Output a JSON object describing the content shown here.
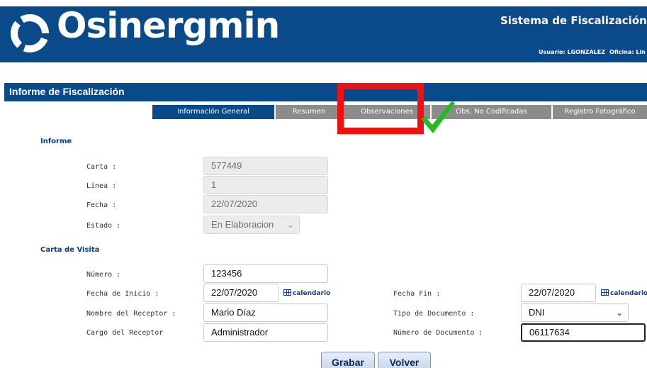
{
  "header": {
    "brand": "Osinergmin",
    "system_title": "Sistema de Fiscalización e",
    "user_label": "Usuario: LGONZALEZ",
    "office_label": "Oficina: Lin"
  },
  "section": {
    "title": "Informe de Fiscalización"
  },
  "tabs": [
    {
      "label": "Información General",
      "active": true
    },
    {
      "label": "Resumen",
      "active": false
    },
    {
      "label": "Observaciones",
      "active": false
    },
    {
      "label": "Obs. No Codificadas",
      "active": false
    },
    {
      "label": "Registro Fotográfico",
      "active": false
    }
  ],
  "informe": {
    "title": "Informe",
    "carta_label": "Carta :",
    "carta_value": "577449",
    "linea_label": "Línea :",
    "linea_value": "1",
    "fecha_label": "Fecha :",
    "fecha_value": "22/07/2020",
    "estado_label": "Estado :",
    "estado_value": "En Elaboracion"
  },
  "carta_visita": {
    "title": "Carta de Visita",
    "numero_label": "Número :",
    "numero_value": "123456",
    "fecha_inicio_label": "Fecha de Inicio :",
    "fecha_inicio_value": "22/07/2020",
    "fecha_fin_label": "Fecha Fin :",
    "fecha_fin_value": "22/07/2020",
    "calendar_label": "calendario",
    "receptor_label": "Nombre del Receptor :",
    "receptor_value": "Mario Díaz",
    "tipo_doc_label": "Tipo de Documento :",
    "tipo_doc_value": "DNI",
    "cargo_label": "Cargo del Receptor",
    "cargo_value": "Administrador",
    "num_doc_label": "Número de Documento :",
    "num_doc_value": "06117634"
  },
  "buttons": {
    "save": "Grabar",
    "back": "Volver"
  },
  "colors": {
    "header_bg": "#0a4a8a",
    "tab_inactive": "#8c8c8c",
    "highlight_red": "#ee1111",
    "check_green": "#22bb22"
  },
  "annotations": {
    "highlight": "red-rectangle",
    "mark": "green-checkmark-icon"
  }
}
